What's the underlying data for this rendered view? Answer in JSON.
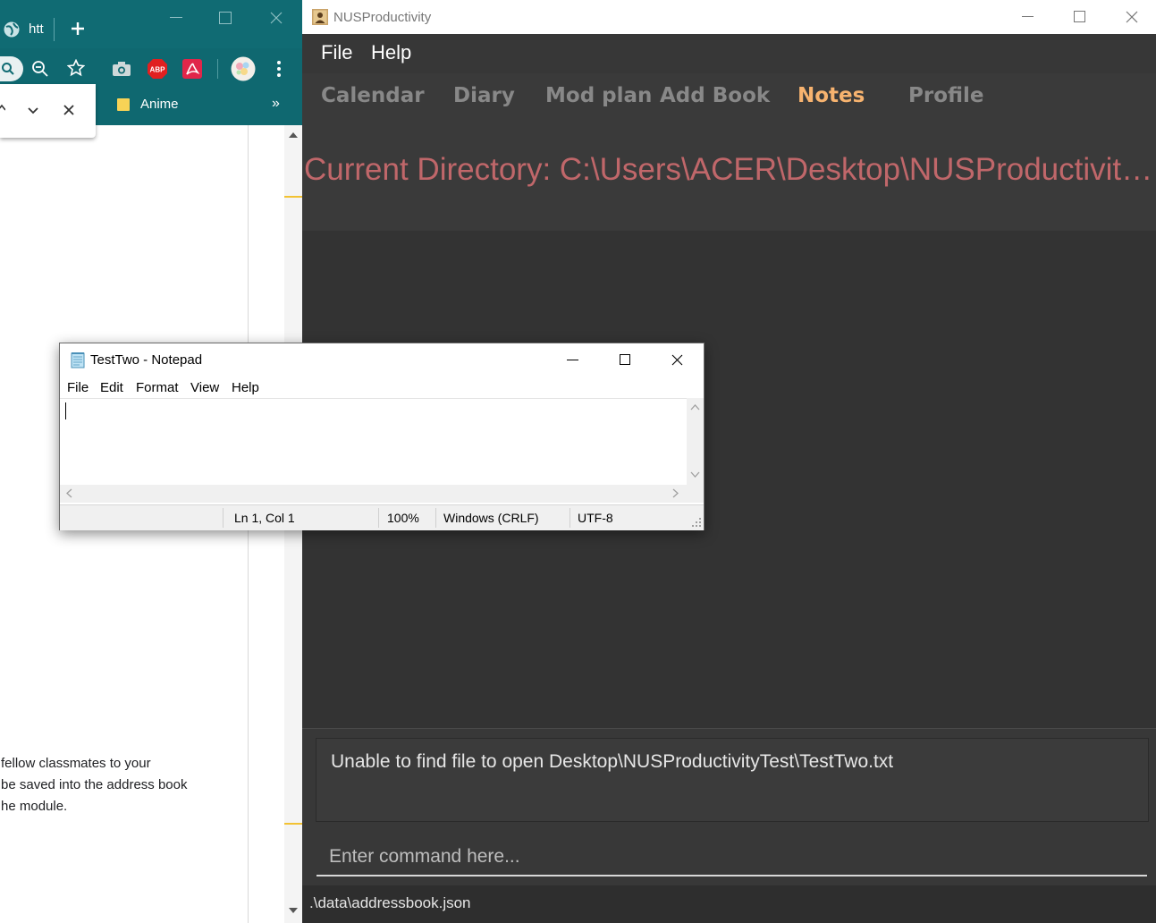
{
  "chrome": {
    "tab_label": "htt",
    "bookmark_label": "Anime",
    "bookmarks_overflow": "»",
    "page_lines": [
      "fellow classmates to your",
      " be saved into the address book",
      "he module."
    ]
  },
  "app": {
    "title": "NUSProductivity",
    "menu": {
      "file": "File",
      "help": "Help"
    },
    "tabs": [
      {
        "label": "Calendar",
        "active": false
      },
      {
        "label": "Diary",
        "active": false
      },
      {
        "label": "Mod plan",
        "active": false
      },
      {
        "label": "Add Book",
        "active": false
      },
      {
        "label": "Notes",
        "active": true
      },
      {
        "label": "Profile",
        "active": false
      }
    ],
    "current_directory": "Current Directory: C:\\Users\\ACER\\Desktop\\NUSProductivityTest",
    "result_message": "Unable to find file to open Desktop\\NUSProductivityTest\\TestTwo.txt",
    "command_placeholder": "Enter command here...",
    "status_path": ".\\data\\addressbook.json",
    "colors": {
      "background": "#3c3c3c",
      "active_tab": "#f7b36f",
      "inactive_tab": "#888888",
      "directory_text": "#c0676a"
    }
  },
  "notepad": {
    "title": "TestTwo - Notepad",
    "menu": [
      "File",
      "Edit",
      "Format",
      "View",
      "Help"
    ],
    "status": {
      "position": "Ln 1, Col 1",
      "zoom": "100%",
      "line_endings": "Windows (CRLF)",
      "encoding": "UTF-8"
    }
  }
}
